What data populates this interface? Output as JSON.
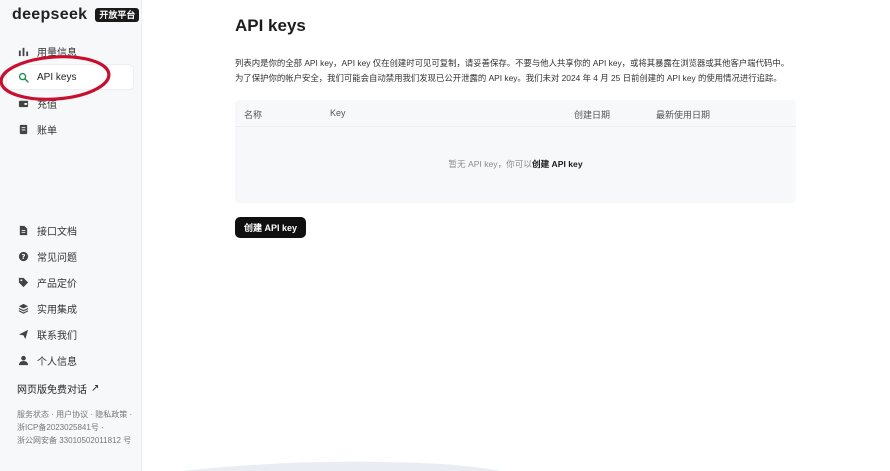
{
  "brand": {
    "name": "deepseek",
    "badge": "开放平台"
  },
  "sidebar": {
    "top_items": [
      {
        "label": "用量信息",
        "icon": "bar-chart-icon"
      },
      {
        "label": "API keys",
        "icon": "search-icon",
        "active": true
      },
      {
        "label": "充值",
        "icon": "wallet-icon"
      },
      {
        "label": "账单",
        "icon": "receipt-icon"
      }
    ],
    "bottom_items": [
      {
        "label": "接口文档",
        "icon": "document-icon"
      },
      {
        "label": "常见问题",
        "icon": "help-icon"
      },
      {
        "label": "产品定价",
        "icon": "price-tag-icon"
      },
      {
        "label": "实用集成",
        "icon": "layers-icon"
      },
      {
        "label": "联系我们",
        "icon": "send-icon"
      },
      {
        "label": "个人信息",
        "icon": "user-icon"
      }
    ],
    "free_chat": {
      "label": "网页版免费对话",
      "arrow": "↗"
    },
    "footer": {
      "line1": "服务状态 · 用户协议 · 隐私政策 ·",
      "line2": "浙ICP备2023025841号 ·",
      "line3": "浙公网安备 33010502011812 号"
    }
  },
  "main": {
    "title": "API keys",
    "description_line1": "列表内是你的全部 API key，API key 仅在创建时可见可复制，请妥善保存。不要与他人共享你的 API key，或将其暴露在浏览器或其他客户端代码中。",
    "description_line2": "为了保护你的帐户安全，我们可能会自动禁用我们发现已公开泄露的 API key。我们未对 2024 年 4 月 25 日前创建的 API key 的使用情况进行追踪。",
    "table": {
      "columns": [
        "名称",
        "Key",
        "创建日期",
        "最新使用日期"
      ],
      "empty_text": "暂无 API key，你可以",
      "empty_link": "创建 API key"
    },
    "create_button": "创建 API key"
  },
  "colors": {
    "accent": "#101010",
    "annotation": "#c8102e",
    "sidebar_bg": "#f7f8fa"
  }
}
